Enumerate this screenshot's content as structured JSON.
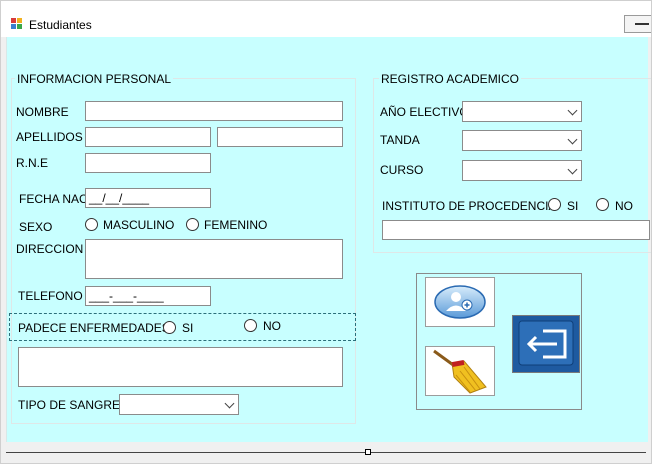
{
  "window": {
    "title": "Estudiantes"
  },
  "personal": {
    "group_title": "INFORMACION PERSONAL",
    "nombre_label": "NOMBRE",
    "apellidos_label": "APELLIDOS",
    "rne_label": "R.N.E",
    "fecha_label": "FECHA NAC.",
    "fecha_mask": "__/__/____",
    "sexo_label": "SEXO",
    "masculino_label": "MASCULINO",
    "femenino_label": "FEMENINO",
    "direccion_label": "DIRECCION",
    "telefono_label": "TELEFONO",
    "telefono_mask": "___-___-____",
    "enfermedades_label": "PADECE ENFERMEDADES",
    "si_label": "SI",
    "no_label": "NO",
    "tipo_sangre_label": "TIPO DE SANGRE"
  },
  "academico": {
    "group_title": "REGISTRO ACADEMICO",
    "ano_label": "AÑO ELECTIVO",
    "tanda_label": "TANDA",
    "curso_label": "CURSO",
    "instituto_label": "INSTITUTO DE PROCEDENCIA",
    "si_label": "SI",
    "no_label": "NO"
  },
  "icons": {
    "add_user": "add-user-icon",
    "clear": "broom-icon",
    "exit": "exit-icon"
  },
  "colors": {
    "client_bg": "#c8ffff",
    "accent_blue": "#1a5aa8"
  }
}
